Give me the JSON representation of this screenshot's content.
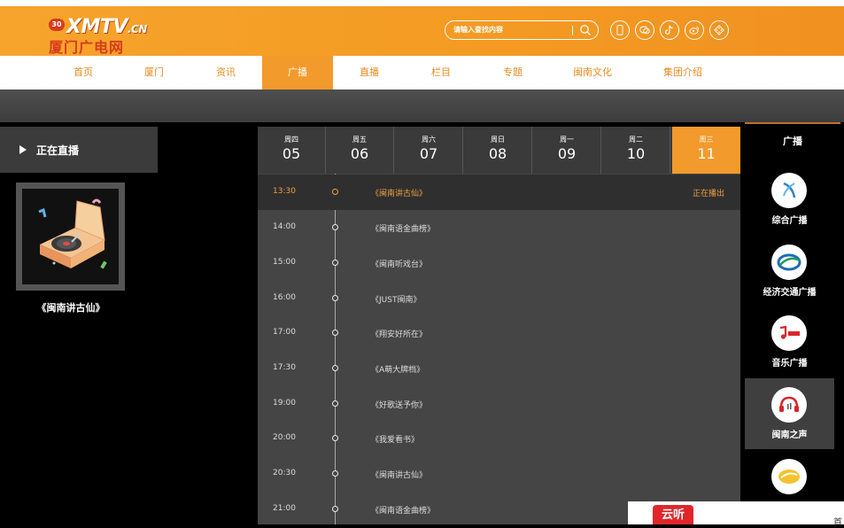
{
  "header": {
    "logo_main": "XMTV",
    "logo_suffix": ".CN",
    "logo_sub": "厦门广电网",
    "logo_badge": "30",
    "search_placeholder": "请输入查找内容"
  },
  "nav": {
    "items": [
      "首页",
      "厦门",
      "资讯",
      "广播",
      "直播",
      "栏目",
      "专题",
      "闽南文化",
      "集团介绍"
    ],
    "active_index": 3
  },
  "left": {
    "now_playing_label": "正在直播",
    "cover_title": "《闽南讲古仙》"
  },
  "days": [
    {
      "weekday": "周四",
      "date": "05"
    },
    {
      "weekday": "周五",
      "date": "06"
    },
    {
      "weekday": "周六",
      "date": "07"
    },
    {
      "weekday": "周日",
      "date": "08"
    },
    {
      "weekday": "周一",
      "date": "09"
    },
    {
      "weekday": "周二",
      "date": "10"
    },
    {
      "weekday": "周三",
      "date": "11"
    }
  ],
  "active_day_index": 6,
  "schedule": [
    {
      "time": "13:30",
      "program": "《闽南讲古仙》",
      "status": "正在播出"
    },
    {
      "time": "14:00",
      "program": "《闽南语金曲榜》"
    },
    {
      "time": "15:00",
      "program": "《闽南听戏台》"
    },
    {
      "time": "16:00",
      "program": "《JUST闽南》"
    },
    {
      "time": "17:00",
      "program": "《翔安好所在》"
    },
    {
      "time": "17:30",
      "program": "《A萌大牌档》"
    },
    {
      "time": "19:00",
      "program": "《好歌送予你》"
    },
    {
      "time": "20:00",
      "program": "《我爱看书》"
    },
    {
      "time": "20:30",
      "program": "《闽南讲古仙》"
    },
    {
      "time": "21:00",
      "program": "《闽南语金曲榜》"
    }
  ],
  "sidebar": {
    "title": "广播",
    "stations": [
      {
        "name": "综合广播",
        "icon": "radio-news-logo-icon"
      },
      {
        "name": "经济交通广播",
        "icon": "radio-traffic-logo-icon"
      },
      {
        "name": "音乐广播",
        "icon": "radio-music-logo-icon"
      },
      {
        "name": "闽南之声",
        "icon": "radio-minnan-logo-icon"
      },
      {
        "name": "",
        "icon": "radio-fifth-logo-icon"
      }
    ],
    "active_index": 3
  },
  "popup": {
    "logo_text": "云听",
    "text": "首"
  },
  "colors": {
    "accent": "#f39a2c",
    "active_text": "#f0a040",
    "logo_red": "#d9391c",
    "popup_red": "#e0262a"
  }
}
